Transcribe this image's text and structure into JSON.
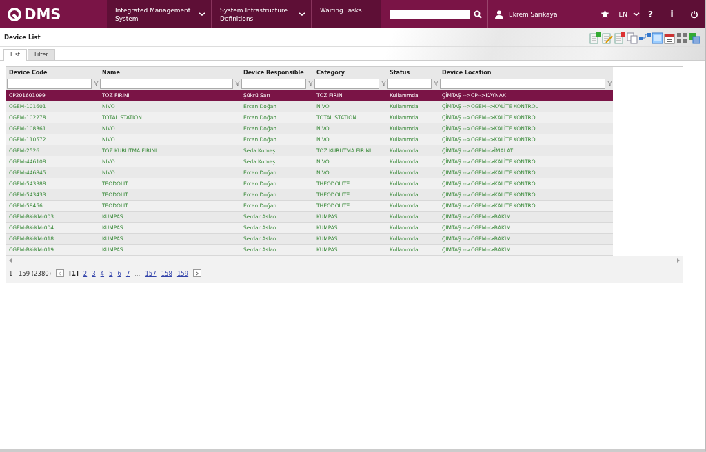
{
  "header": {
    "logo": "DMS",
    "nav": [
      {
        "label": "Integrated Management System",
        "dropdown": true
      },
      {
        "label": "System Infrastructure Definitions",
        "dropdown": true
      },
      {
        "label": "Waiting Tasks",
        "dropdown": false
      }
    ],
    "user": "Ekrem Sarıkaya",
    "language": "EN",
    "help": "?",
    "info": "i"
  },
  "page": {
    "title": "Device List"
  },
  "tabs": [
    {
      "label": "List",
      "selected": true
    },
    {
      "label": "Filter",
      "selected": false
    }
  ],
  "table": {
    "columns": [
      "Device Code",
      "Name",
      "Device Responsible",
      "Category",
      "Status",
      "Device Location"
    ],
    "rows": [
      {
        "selected": true,
        "cells": [
          "CP201601099",
          "TOZ FIRINI",
          "Şükrü Sarı",
          "TOZ FIRINI",
          "Kullanımda",
          "ÇİMTAŞ -->CP-->KAYNAK"
        ]
      },
      {
        "selected": false,
        "cells": [
          "CGEM-101601",
          "NIVO",
          "Ercan Doğan",
          "NIVO",
          "Kullanımda",
          "ÇİMTAŞ -->CGEM-->KALİTE KONTROL"
        ]
      },
      {
        "selected": false,
        "cells": [
          "CGEM-102278",
          "TOTAL STATION",
          "Ercan Doğan",
          "TOTAL STATION",
          "Kullanımda",
          "ÇİMTAŞ -->CGEM-->KALİTE KONTROL"
        ]
      },
      {
        "selected": false,
        "cells": [
          "CGEM-108361",
          "NIVO",
          "Ercan Doğan",
          "NIVO",
          "Kullanımda",
          "ÇİMTAŞ -->CGEM-->KALİTE KONTROL"
        ]
      },
      {
        "selected": false,
        "cells": [
          "CGEM-110572",
          "NIVO",
          "Ercan Doğan",
          "NIVO",
          "Kullanımda",
          "ÇİMTAŞ -->CGEM-->KALİTE KONTROL"
        ]
      },
      {
        "selected": false,
        "cells": [
          "CGEM-2526",
          "TOZ KURUTMA FIRINI",
          "Seda Kumaş",
          "TOZ KURUTMA FIRINI",
          "Kullanımda",
          "ÇİMTAŞ -->CGEM-->İMALAT"
        ]
      },
      {
        "selected": false,
        "cells": [
          "CGEM-446108",
          "NIVO",
          "Seda Kumaş",
          "NIVO",
          "Kullanımda",
          "ÇİMTAŞ -->CGEM-->KALİTE KONTROL"
        ]
      },
      {
        "selected": false,
        "cells": [
          "CGEM-446845",
          "NIVO",
          "Ercan Doğan",
          "NIVO",
          "Kullanımda",
          "ÇİMTAŞ -->CGEM-->KALİTE KONTROL"
        ]
      },
      {
        "selected": false,
        "cells": [
          "CGEM-543388",
          "TEODOLİT",
          "Ercan Doğan",
          "THEODOLİTE",
          "Kullanımda",
          "ÇİMTAŞ -->CGEM-->KALİTE KONTROL"
        ]
      },
      {
        "selected": false,
        "cells": [
          "CGEM-543433",
          "TEODOLİT",
          "Ercan Doğan",
          "THEODOLİTE",
          "Kullanımda",
          "ÇİMTAŞ -->CGEM-->KALİTE KONTROL"
        ]
      },
      {
        "selected": false,
        "cells": [
          "CGEM-58456",
          "TEODOLİT",
          "Ercan Doğan",
          "THEODOLİTE",
          "Kullanımda",
          "ÇİMTAŞ -->CGEM-->KALİTE KONTROL"
        ]
      },
      {
        "selected": false,
        "cells": [
          "CGEM-BK-KM-003",
          "KUMPAS",
          "Serdar Aslan",
          "KUMPAS",
          "Kullanımda",
          "ÇİMTAŞ -->CGEM-->BAKIM"
        ]
      },
      {
        "selected": false,
        "cells": [
          "CGEM-BK-KM-004",
          "KUMPAS",
          "Serdar Aslan",
          "KUMPAS",
          "Kullanımda",
          "ÇİMTAŞ -->CGEM-->BAKIM"
        ]
      },
      {
        "selected": false,
        "cells": [
          "CGEM-BK-KM-018",
          "KUMPAS",
          "Serdar Aslan",
          "KUMPAS",
          "Kullanımda",
          "ÇİMTAŞ -->CGEM-->BAKIM"
        ]
      },
      {
        "selected": false,
        "cells": [
          "CGEM-BK-KM-019",
          "KUMPAS",
          "Serdar Aslan",
          "KUMPAS",
          "Kullanımda",
          "ÇİMTAŞ -->CGEM-->BAKIM"
        ]
      }
    ]
  },
  "pager": {
    "summary": "1 - 159 (2380)",
    "pages": [
      {
        "kind": "current",
        "label": "[1]"
      },
      {
        "kind": "page",
        "label": "2"
      },
      {
        "kind": "page",
        "label": "3"
      },
      {
        "kind": "page",
        "label": "4"
      },
      {
        "kind": "page",
        "label": "5"
      },
      {
        "kind": "page",
        "label": "6"
      },
      {
        "kind": "page",
        "label": "7"
      },
      {
        "kind": "ellipsis",
        "label": "..."
      },
      {
        "kind": "page",
        "label": "157"
      },
      {
        "kind": "page",
        "label": "158"
      },
      {
        "kind": "page",
        "label": "159"
      }
    ]
  }
}
